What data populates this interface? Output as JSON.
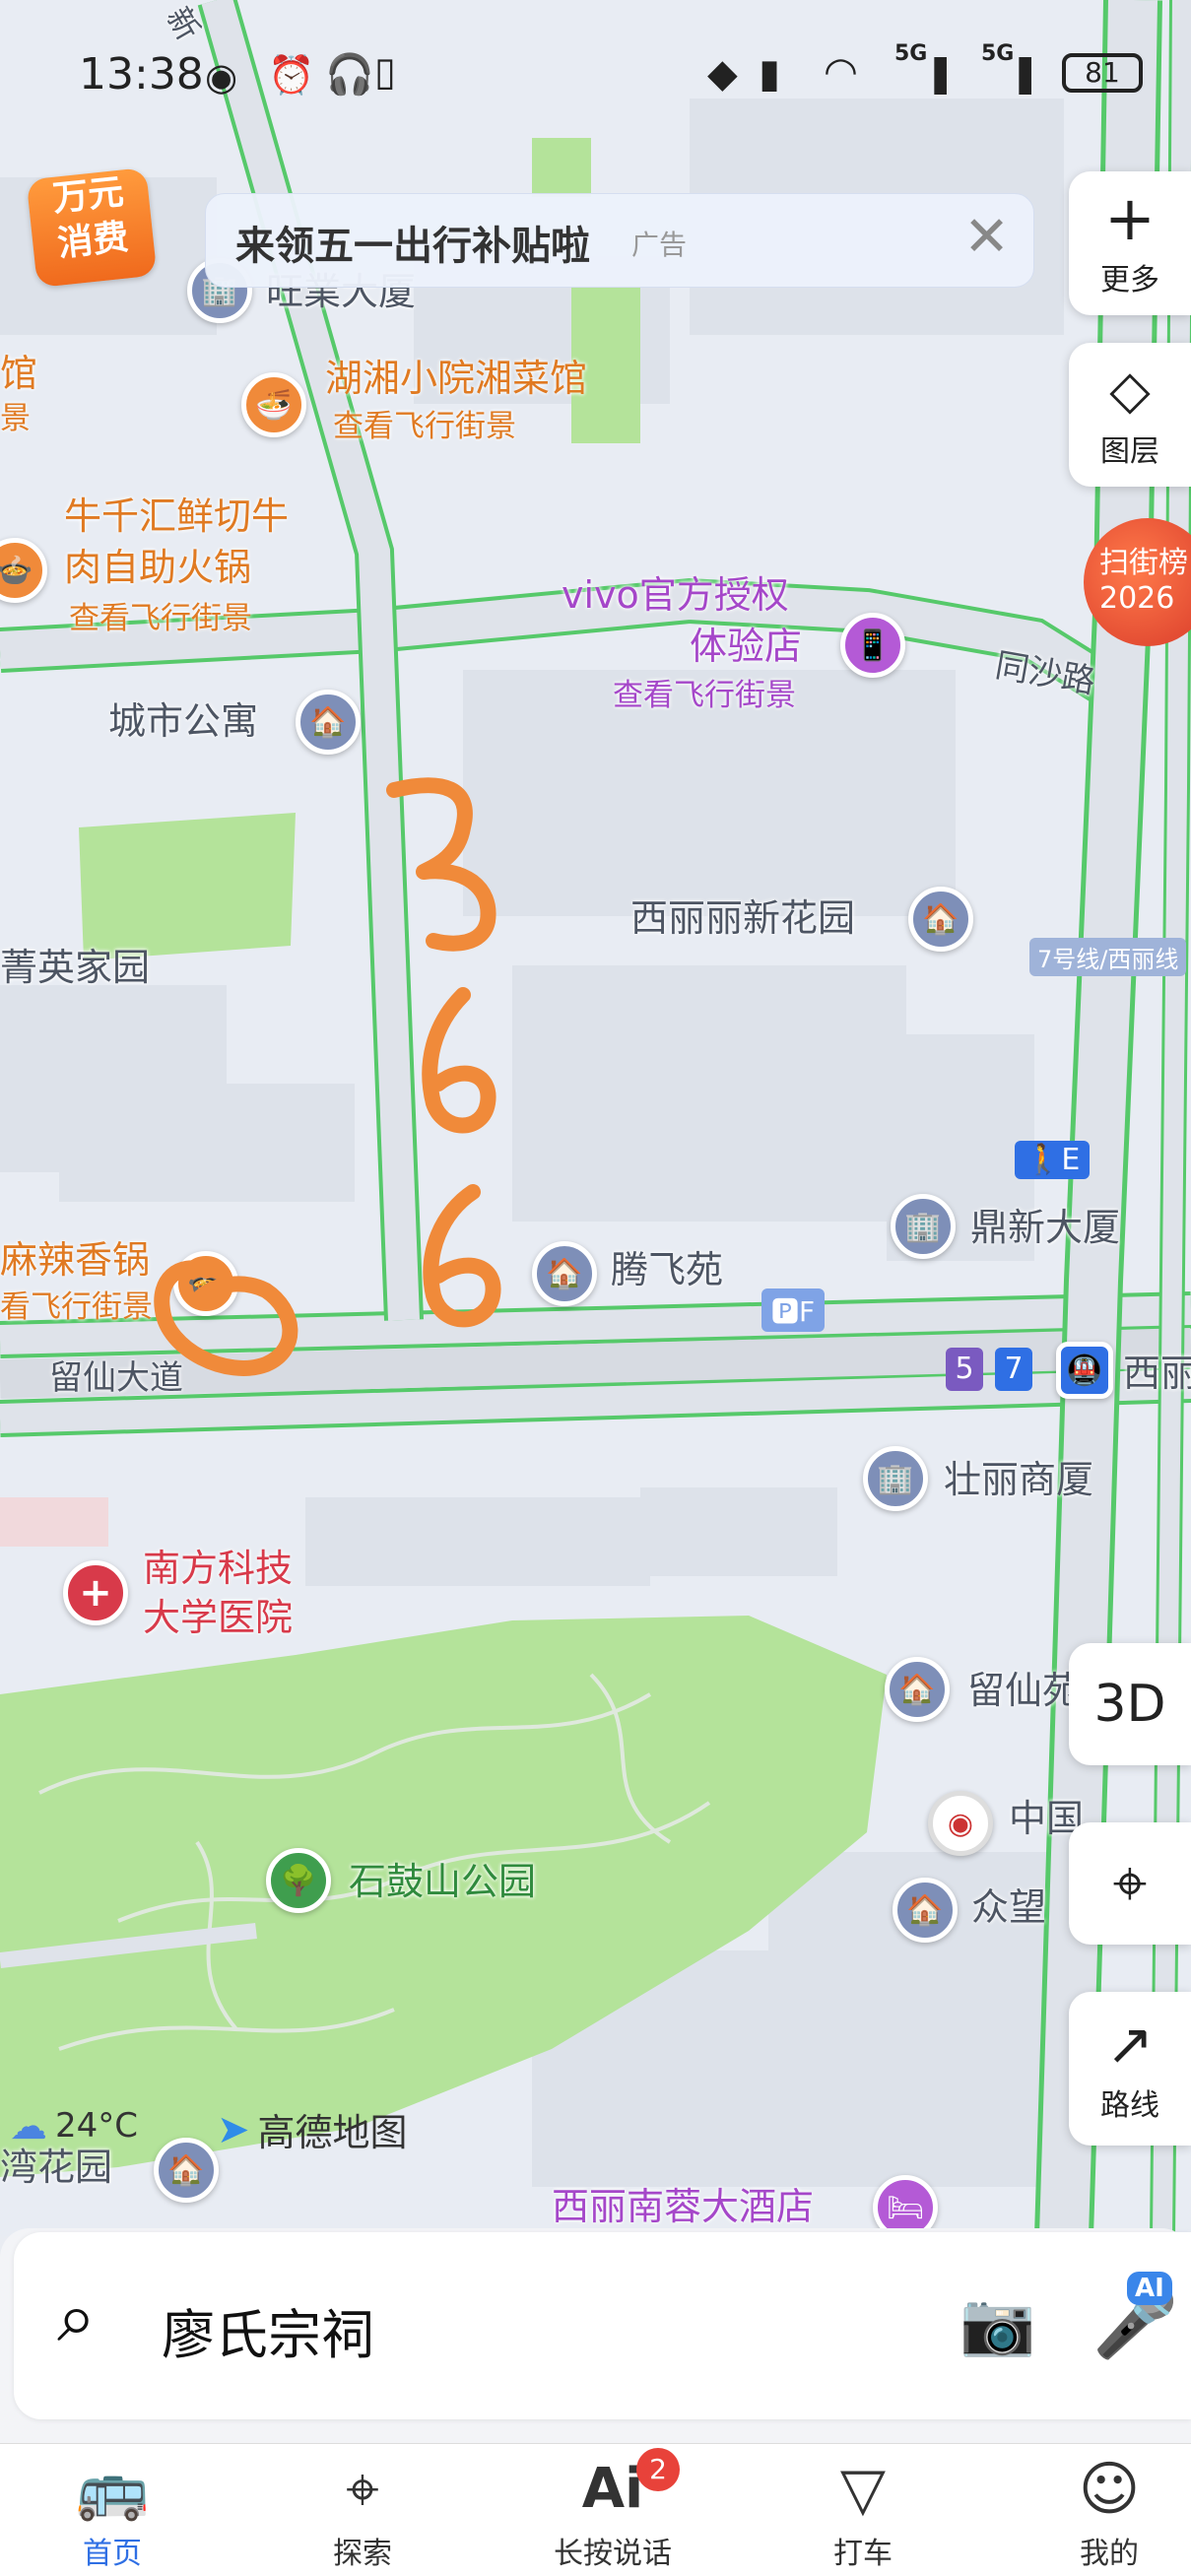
{
  "status_bar": {
    "time": "13:38",
    "net_a": "5G",
    "net_b": "5G",
    "battery": "81"
  },
  "promo_badge": {
    "line1": "万元",
    "line2": "消费"
  },
  "ad_banner": {
    "text": "来领五一出行补贴啦",
    "tag": "广告"
  },
  "side_controls": {
    "more_label": "更多",
    "layers_label": "图层",
    "street_rank_line1": "扫街榜",
    "street_rank_line2": "2026",
    "btn_3d": "3D",
    "route_label": "路线"
  },
  "map": {
    "roads": {
      "tongsha": "同沙路",
      "liuxian": "留仙大道",
      "xin": "新",
      "metro_line": "7号线/西丽线",
      "metro_5": "5",
      "metro_7": "7",
      "xili": "西丽"
    },
    "pois": {
      "wangye": "旺業大厦",
      "guan": "馆",
      "jing": "景",
      "hunan_name": "湖湘小院湘菜馆",
      "hunan_sub": "查看飞行街景",
      "niuqian_line1": "牛千汇鲜切牛",
      "niuqian_line2": "肉自助火锅",
      "niuqian_sub": "查看飞行街景",
      "vivo_line1": "vivo官方授权",
      "vivo_line2": "体验店",
      "vivo_sub": "查看飞行街景",
      "chengshi": "城市公寓",
      "jingying": "菁英家园",
      "xilili": "西丽丽新花园",
      "dingxin": "鼎新大厦",
      "tengfei": "腾飞苑",
      "malaxiang": "麻辣香锅",
      "mala_sub": "看飞行街景",
      "zhuangli": "壮丽商厦",
      "hospital_line1": "南方科技",
      "hospital_line2": "大学医院",
      "liuxianyuan": "留仙苑",
      "zhongguo": "中国",
      "zhongwang": "众望",
      "park": "石鼓山公园",
      "wanhua": "湾花园",
      "hotel": "西丽南蓉大酒店",
      "exit_e": "E",
      "parking_f": "F"
    },
    "weather": "24°C",
    "brand": "高德地图",
    "handwriting": "366"
  },
  "search": {
    "query": "廖氏宗祠",
    "ai_badge": "AI"
  },
  "tabs": [
    {
      "label": "首页",
      "icon": "bus-icon"
    },
    {
      "label": "探索",
      "icon": "location-pin-icon"
    },
    {
      "label": "长按说话",
      "icon": "ai-icon",
      "badge": "2"
    },
    {
      "label": "打车",
      "icon": "taxi-icon"
    },
    {
      "label": "我的",
      "icon": "user-icon"
    }
  ],
  "colors": {
    "road_green": "#56c96a",
    "park_green": "#b4e39a",
    "accent_blue": "#2f6fe4",
    "poi_orange": "#e07a22",
    "handwriting": "#f08a3a"
  }
}
